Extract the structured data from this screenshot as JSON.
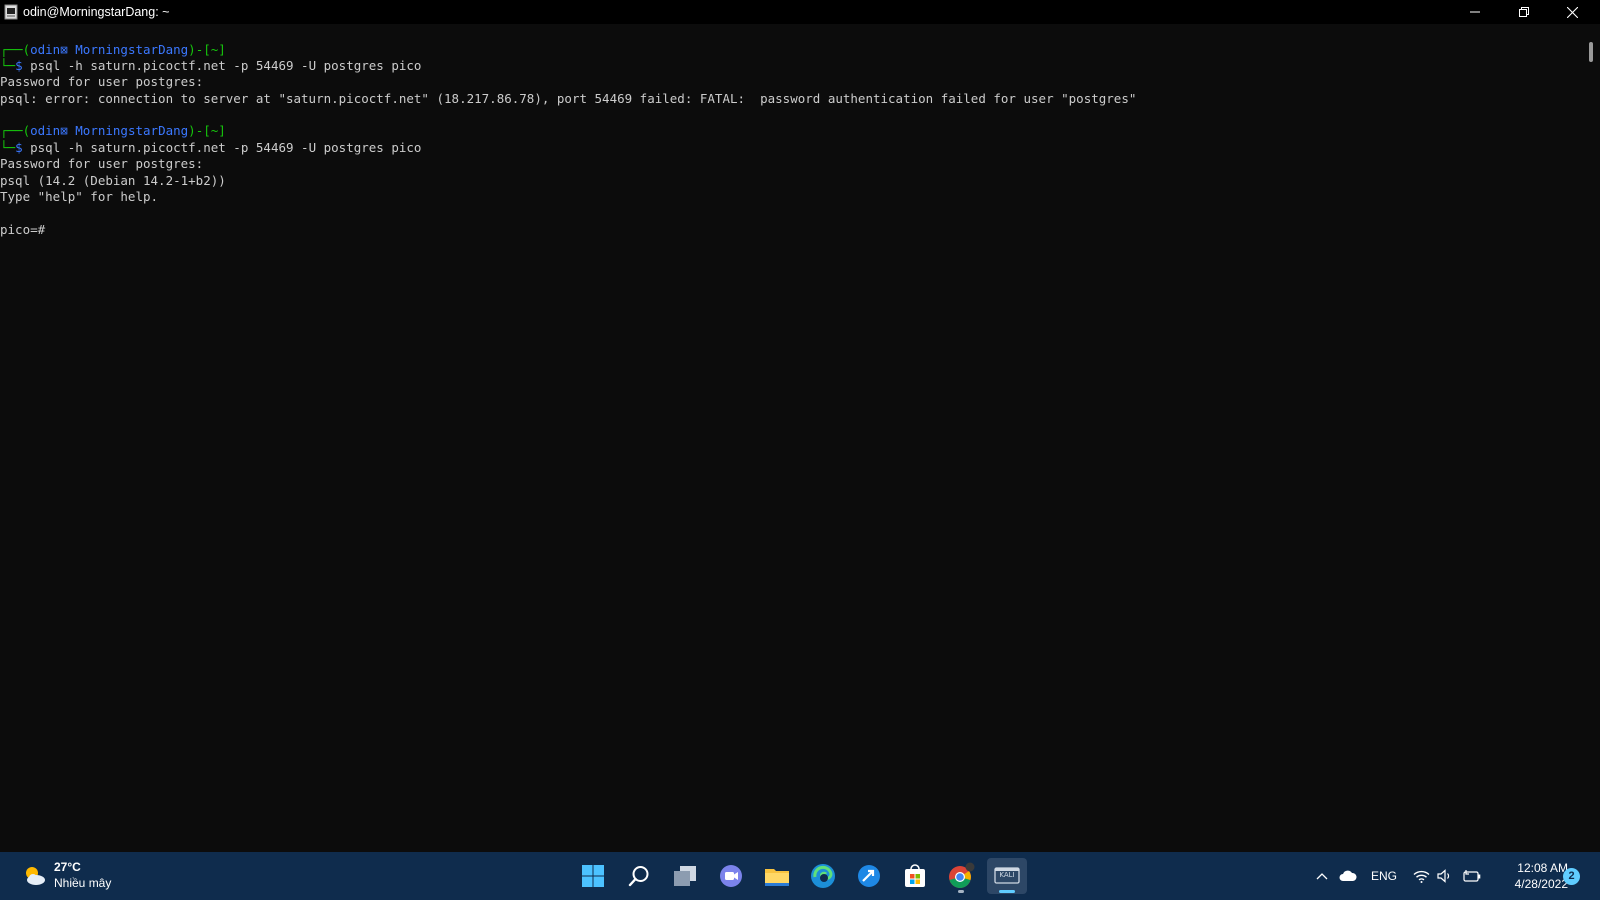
{
  "window": {
    "title": "odin@MorningstarDang: ~",
    "buttons": {
      "minimize": "minimize-icon",
      "maximize": "restore-icon",
      "close": "close-icon"
    }
  },
  "terminal": {
    "prompt": {
      "frame_top": "┌──(",
      "user": "odin",
      "glyph": "⊠",
      "host": "MorningstarDang",
      "mid": ")-[",
      "path": "~",
      "end": "]",
      "frame_bottom": "└─",
      "dollar": "$"
    },
    "command": " psql -h saturn.picoctf.net -p 54469 -U postgres pico",
    "line_password": "Password for user postgres:",
    "line_error": "psql: error: connection to server at \"saturn.picoctf.net\" (18.217.86.78), port 54469 failed: FATAL:  password authentication failed for user \"postgres\"",
    "line_version": "psql (14.2 (Debian 14.2-1+b2))",
    "line_help": "Type \"help\" for help.",
    "line_prompt": "pico=#"
  },
  "taskbar": {
    "weather": {
      "temp": "27°C",
      "condition": "Nhiều mây"
    },
    "apps": [
      "start-icon",
      "search-icon",
      "task-view-icon",
      "chat-icon",
      "file-explorer-icon",
      "edge-icon",
      "app-icon",
      "store-icon",
      "chrome-icon",
      "kali-terminal-icon"
    ],
    "kali_label": "KALI",
    "tray": {
      "language": "ENG"
    },
    "clock": {
      "time": "12:08 AM",
      "date": "4/28/2022"
    },
    "notification_count": "2"
  },
  "colors": {
    "prompt_frame": "#16c60c",
    "prompt_user": "#3b78ff",
    "terminal_bg": "#0c0c0c",
    "taskbar_bg": "#0f2c4d"
  }
}
